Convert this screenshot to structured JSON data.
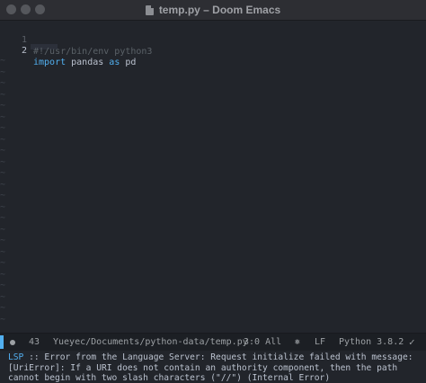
{
  "window": {
    "title": "temp.py – Doom Emacs"
  },
  "editor": {
    "lines": [
      {
        "number": "1",
        "tokens": [
          {
            "text": "#!/usr/bin/env python3",
            "kind": "comment"
          }
        ]
      },
      {
        "number": "2",
        "tokens": [
          {
            "text": "import",
            "kind": "keyword"
          },
          {
            "text": " pandas ",
            "kind": "text"
          },
          {
            "text": "as",
            "kind": "keyword"
          },
          {
            "text": " pd",
            "kind": "text"
          }
        ]
      }
    ],
    "empty_marker": "~"
  },
  "modeline": {
    "line_count": "43",
    "file_path": "Yueyec/Documents/python-data/temp.py",
    "position": "3:0 All",
    "eol": "LF",
    "mode": "Python 3.8.2"
  },
  "echo_area": {
    "lsp_prefix": "LSP",
    "line1_rest": " :: Error from the Language Server: Request initialize failed with message:",
    "line2": "[UriError]: If a URI does not contain an authority component, then the path",
    "line3": "cannot begin with two slash characters (\"//\") (Internal Error)"
  },
  "colors": {
    "background": "#22252b",
    "keyword": "#51afef",
    "comment": "#5b6268",
    "text": "#bbc2cf"
  }
}
